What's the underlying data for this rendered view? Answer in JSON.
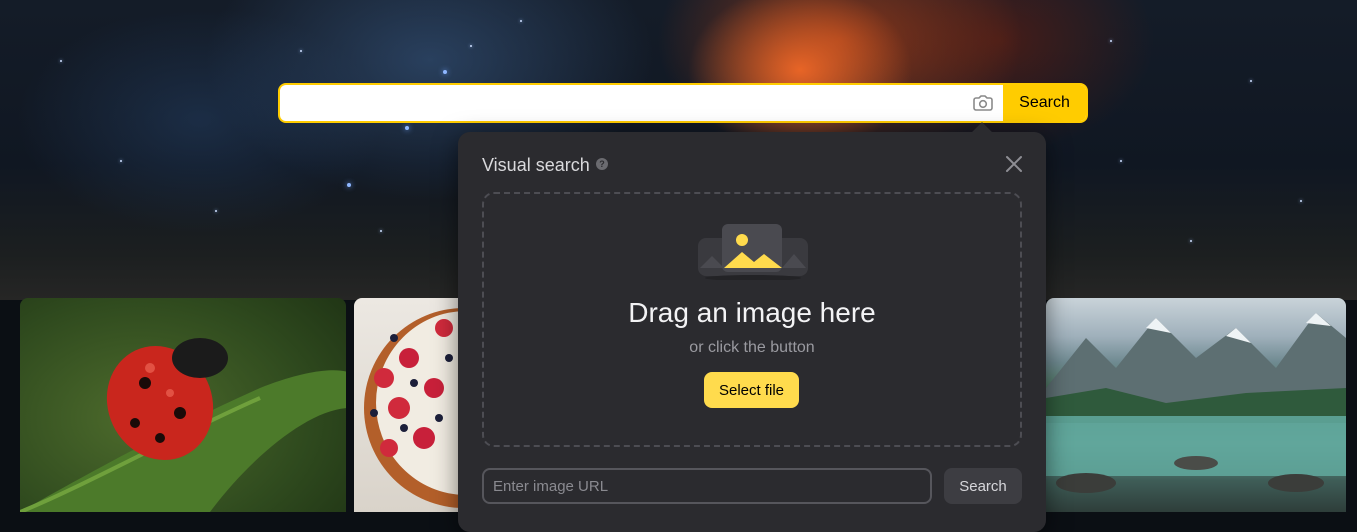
{
  "search": {
    "value": "",
    "camera_icon": "camera-icon",
    "button_label": "Search",
    "accent_color": "#ffcc00"
  },
  "tiles": [
    {
      "name": "ladybug-image"
    },
    {
      "name": "berry-tart-image"
    },
    {
      "name": "mountain-lake-image"
    }
  ],
  "visual_search": {
    "title": "Visual search",
    "help_icon": "help-icon",
    "help_glyph": "?",
    "close_icon": "close-icon",
    "dropzone": {
      "illustration": "image-placeholder-icon",
      "title": "Drag an image here",
      "subtitle": "or click the button",
      "select_button": "Select file"
    },
    "url_input": {
      "value": "",
      "placeholder": "Enter image URL"
    },
    "url_search_button": "Search",
    "background_color": "#2b2b2f",
    "select_button_color": "#ffdb4d"
  }
}
